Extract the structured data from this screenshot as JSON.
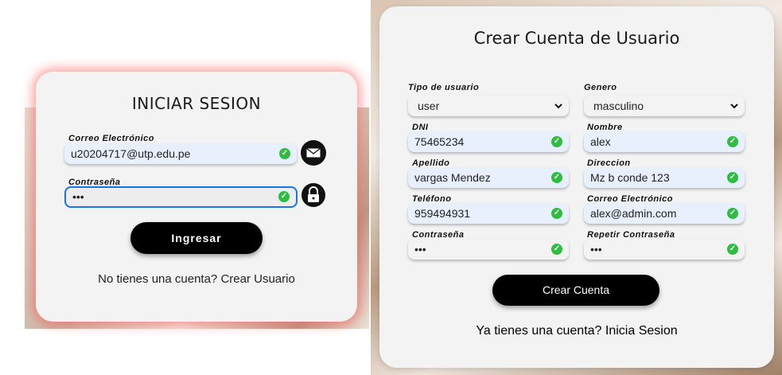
{
  "login": {
    "title": "INICIAR SESION",
    "email_label": "Correo Electrónico",
    "email_value": "u20204717@utp.edu.pe",
    "password_label": "Contraseña",
    "password_value": "•••",
    "submit_label": "Ingresar",
    "footer_text": "No tienes una cuenta?",
    "footer_link": "Crear Usuario"
  },
  "register": {
    "title": "Crear Cuenta de Usuario",
    "user_type_label": "Tipo de usuario",
    "user_type_value": "user",
    "gender_label": "Genero",
    "gender_value": "masculino",
    "dni_label": "DNI",
    "dni_value": "75465234",
    "name_label": "Nombre",
    "name_value": "alex",
    "lastname_label": "Apellido",
    "lastname_value": "vargas Mendez",
    "address_label": "Direccion",
    "address_value": "Mz b conde 123",
    "phone_label": "Teléfono",
    "phone_value": "959494931",
    "email_label": "Correo Electrónico",
    "email_value": "alex@admin.com",
    "password_label": "Contraseña",
    "password_value": "•••",
    "repeat_password_label": "Repetir Contraseña",
    "repeat_password_value": "•••",
    "submit_label": "Crear Cuenta",
    "footer_text": "Ya tienes una cuenta?",
    "footer_link": "Inicia Sesion"
  },
  "icons": {
    "check": "✓",
    "mail": "mail-icon",
    "lock": "lock-icon"
  },
  "colors": {
    "accent_focus": "#1a73e8",
    "valid_check": "#2ebd3f",
    "button_bg": "#000000",
    "login_glow": "#ff5050"
  }
}
